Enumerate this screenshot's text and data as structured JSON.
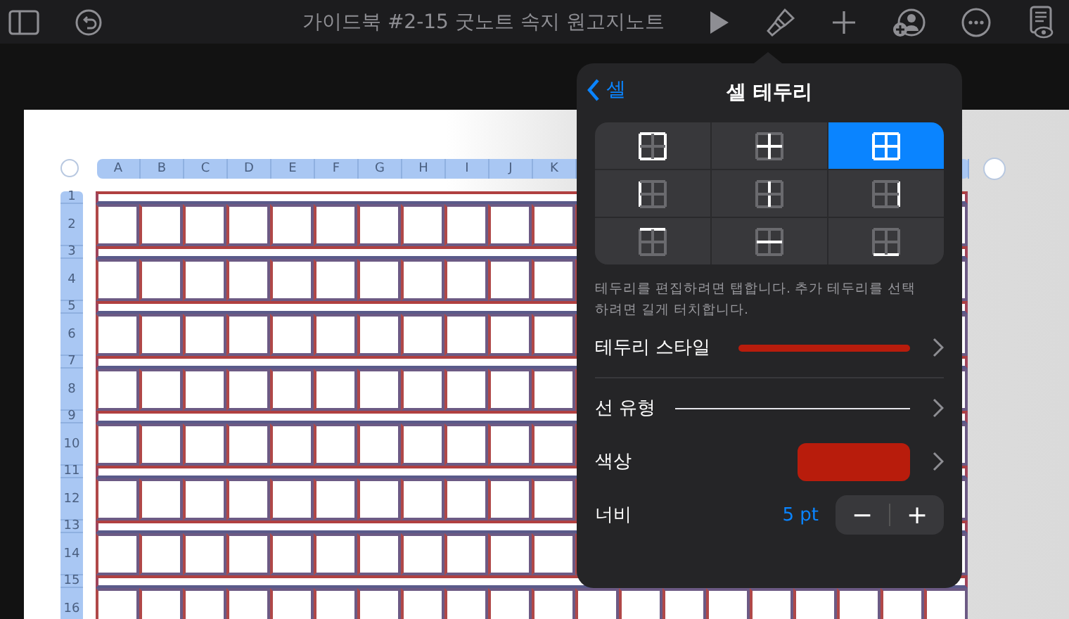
{
  "toolbar": {
    "title": "가이드북 #2-15 굿노트 속지 원고지노트"
  },
  "sheet": {
    "columns": [
      "A",
      "B",
      "C",
      "D",
      "E",
      "F",
      "G",
      "H",
      "I",
      "J",
      "K"
    ],
    "rows": [
      "1",
      "2",
      "3",
      "4",
      "5",
      "6",
      "7",
      "8",
      "9",
      "10",
      "11",
      "12",
      "13",
      "14",
      "15",
      "16"
    ]
  },
  "popover": {
    "back": "셀",
    "title": "셀 테두리",
    "borders": [
      {
        "kind": "outer",
        "selected": false
      },
      {
        "kind": "inner",
        "selected": false
      },
      {
        "kind": "all",
        "selected": true
      },
      {
        "kind": "left",
        "selected": false
      },
      {
        "kind": "inner-vertical",
        "selected": false
      },
      {
        "kind": "right",
        "selected": false
      },
      {
        "kind": "top",
        "selected": false
      },
      {
        "kind": "inner-horizontal",
        "selected": false
      },
      {
        "kind": "bottom",
        "selected": false
      }
    ],
    "hint": "테두리를 편집하려면 탭합니다. 추가 테두리를 선택하려면 길게 터치합니다.",
    "style_label": "테두리 스타일",
    "line_label": "선 유형",
    "color_label": "색상",
    "color": "#b81c0c",
    "width_label": "너비",
    "width_value": "5 pt",
    "minus": "−",
    "plus": "+"
  }
}
